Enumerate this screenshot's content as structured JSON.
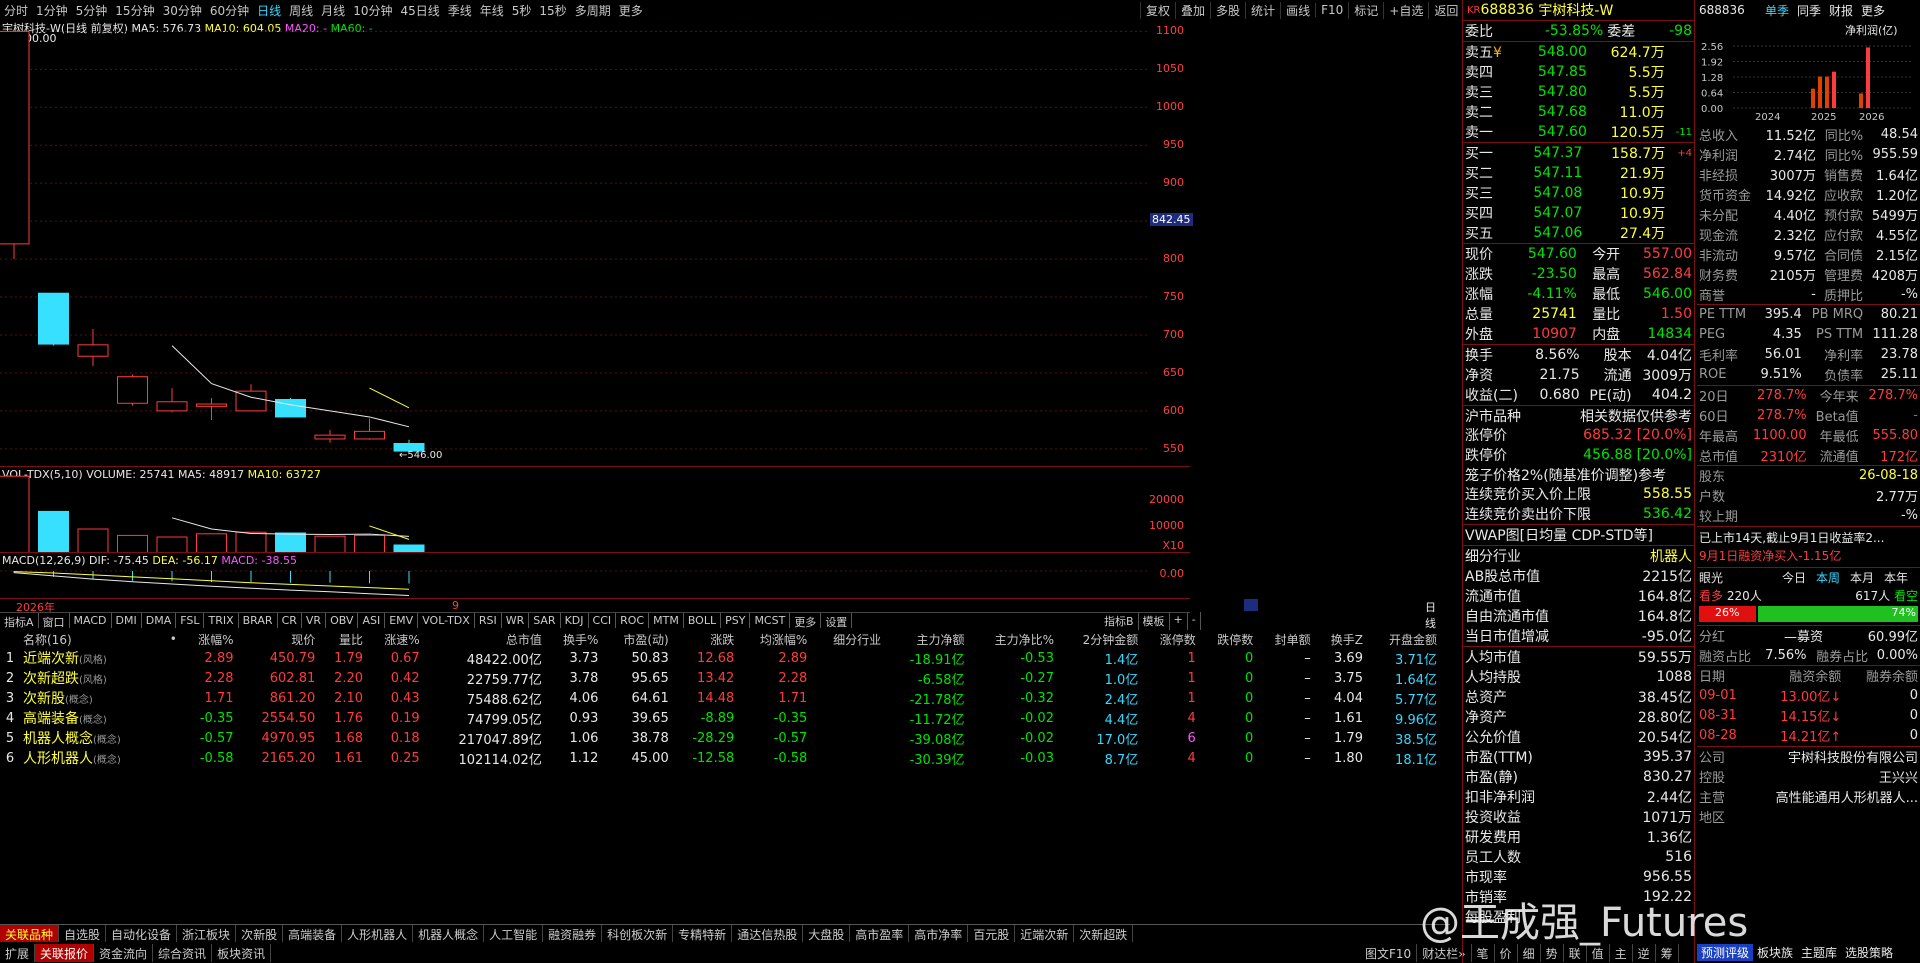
{
  "topbar": {
    "periods": [
      "分时",
      "1分钟",
      "5分钟",
      "15分钟",
      "30分钟",
      "60分钟",
      "日线",
      "周线",
      "月线",
      "10分钟",
      "45日线",
      "季线",
      "年线",
      "5秒",
      "15秒",
      "多周期",
      "更多"
    ],
    "active": "日线",
    "tools": [
      "复权",
      "叠加",
      "多股",
      "统计",
      "画线",
      "F10",
      "标记",
      "+自选",
      "返回"
    ]
  },
  "chart": {
    "title": "宇树科技-W(日线 前复权)",
    "ma5": "MA5: 576.73",
    "ma10": "MA10: 604.05",
    "ma20": "MA20: -",
    "ma60": "MA60: -",
    "high_label": "100.00",
    "low_label": "546.00",
    "cursor_price": "842.45",
    "y_ticks": [
      "1100",
      "1050",
      "1000",
      "950",
      "900",
      "850",
      "800",
      "750",
      "700",
      "650",
      "600",
      "550"
    ],
    "date_left": "2026年",
    "date_mid": "9",
    "date_label": "日线"
  },
  "chart_data": {
    "type": "candlestick",
    "candles": [
      {
        "o": 820,
        "c": 1100,
        "h": 1100,
        "l": 800
      },
      {
        "o": 755,
        "c": 688,
        "h": 755,
        "l": 686
      },
      {
        "o": 672,
        "c": 687,
        "h": 708,
        "l": 659
      },
      {
        "o": 610,
        "c": 645,
        "h": 648,
        "l": 607
      },
      {
        "o": 600,
        "c": 612,
        "h": 630,
        "l": 598
      },
      {
        "o": 606,
        "c": 609,
        "h": 617,
        "l": 588
      },
      {
        "o": 600,
        "c": 626,
        "h": 635,
        "l": 600
      },
      {
        "o": 615,
        "c": 592,
        "h": 617,
        "l": 592
      },
      {
        "o": 563,
        "c": 568,
        "h": 575,
        "l": 558
      },
      {
        "o": 563,
        "c": 573,
        "h": 590,
        "l": 562
      },
      {
        "o": 557,
        "c": 547,
        "h": 562,
        "l": 546
      }
    ],
    "ma5": [
      null,
      null,
      null,
      null,
      686,
      636,
      618,
      608,
      600,
      592,
      579
    ],
    "ma10": [
      null,
      null,
      null,
      null,
      null,
      null,
      null,
      null,
      null,
      630,
      604
    ],
    "volume": [
      48000,
      26000,
      15000,
      11000,
      10000,
      12000,
      13000,
      12500,
      10500,
      11000,
      5000
    ],
    "vol_ma5": [
      null,
      null,
      null,
      null,
      22000,
      15000,
      12200,
      11800,
      11600,
      11800,
      10400
    ],
    "vol_ma10": [
      null,
      null,
      null,
      null,
      null,
      null,
      null,
      null,
      null,
      16900,
      8500
    ],
    "macd_dif": [
      -5,
      -15,
      -25,
      -33,
      -40,
      -47,
      -53,
      -59,
      -64,
      -70,
      -75.45
    ],
    "macd_dea": [
      -2,
      -6,
      -12,
      -18,
      -24,
      -30,
      -36,
      -41,
      -46,
      -51,
      -56.17
    ]
  },
  "volpanel": {
    "title": "VOL-TDX(5,10)",
    "volume": "VOLUME: 25741",
    "ma5": "MA5: 48917",
    "ma10": "MA10: 63727",
    "ticks": [
      "20000",
      "10000"
    ],
    "unit": "X10"
  },
  "macdpanel": {
    "title": "MACD(12,26,9)",
    "dif": "DIF: -75.45",
    "dea": "DEA: -56.17",
    "macd": "MACD: -38.55",
    "tick": "0.00"
  },
  "indtabs": [
    "指标A",
    "窗口",
    "MACD",
    "DMI",
    "DMA",
    "FSL",
    "TRIX",
    "BRAR",
    "CR",
    "VR",
    "OBV",
    "ASI",
    "EMV",
    "VOL-TDX",
    "RSI",
    "WR",
    "SAR",
    "KDJ",
    "CCI",
    "ROC",
    "MTM",
    "BOLL",
    "PSY",
    "MCST",
    "更多",
    "设置"
  ],
  "indtabs_right": [
    "指标B",
    "模板",
    "+",
    "-"
  ],
  "list": {
    "headers": [
      "名称(16)",
      "•",
      "涨幅%",
      "现价",
      "量比",
      "涨速%",
      "总市值",
      "换手%",
      "市盈(动)",
      "涨跌",
      "均涨幅%",
      "细分行业",
      "主力净额",
      "主力净比%",
      "2分钟金额",
      "涨停数",
      "跌停数",
      "封单额",
      "换手Z",
      "开盘金额"
    ],
    "rows": [
      [
        "1",
        "近端次新",
        "(风格)",
        "2.89",
        "450.79",
        "1.79",
        "0.67",
        "48422.00亿",
        "3.73",
        "50.83",
        "12.68",
        "2.89",
        "",
        "-18.91亿",
        "-0.53",
        "1.4亿",
        "1",
        "0",
        "–",
        "3.69",
        "3.71亿"
      ],
      [
        "2",
        "次新超跌",
        "(风格)",
        "2.28",
        "602.81",
        "2.20",
        "0.42",
        "22759.77亿",
        "3.78",
        "95.65",
        "13.42",
        "2.28",
        "",
        "-6.58亿",
        "-0.27",
        "1.0亿",
        "1",
        "0",
        "–",
        "3.75",
        "1.64亿"
      ],
      [
        "3",
        "次新股",
        "(概念)",
        "1.71",
        "861.20",
        "2.10",
        "0.43",
        "75488.62亿",
        "4.06",
        "64.61",
        "14.48",
        "1.71",
        "",
        "-21.78亿",
        "-0.32",
        "2.4亿",
        "1",
        "0",
        "–",
        "4.04",
        "5.77亿"
      ],
      [
        "4",
        "高端装备",
        "(概念)",
        "-0.35",
        "2554.50",
        "1.76",
        "0.19",
        "74799.05亿",
        "0.93",
        "39.65",
        "-8.89",
        "-0.35",
        "",
        "-11.72亿",
        "-0.02",
        "4.4亿",
        "4",
        "0",
        "–",
        "1.61",
        "9.96亿"
      ],
      [
        "5",
        "机器人概念",
        "(概念)",
        "-0.57",
        "4970.95",
        "1.68",
        "0.18",
        "217047.89亿",
        "1.06",
        "38.78",
        "-28.29",
        "-0.57",
        "",
        "-39.08亿",
        "-0.02",
        "17.0亿",
        "6",
        "0",
        "–",
        "1.79",
        "38.5亿"
      ],
      [
        "6",
        "人形机器人",
        "(概念)",
        "-0.58",
        "2165.20",
        "1.61",
        "0.25",
        "102114.02亿",
        "1.12",
        "45.00",
        "-12.58",
        "-0.58",
        "",
        "-30.39亿",
        "-0.03",
        "8.7亿",
        "4",
        "0",
        "–",
        "1.80",
        "18.1亿"
      ]
    ]
  },
  "sectabs": [
    "关联品种",
    "自选股",
    "自动化设备",
    "浙江板块",
    "次新股",
    "高端装备",
    "人形机器人",
    "机器人概念",
    "人工智能",
    "融资融券",
    "科创板次新",
    "专精特新",
    "通达信热股",
    "大盘股",
    "高市盈率",
    "高市净率",
    "百元股",
    "近端次新",
    "次新超跌"
  ],
  "bottom": [
    "扩展",
    "关联报价",
    "资金流向",
    "综合资讯",
    "板块资讯"
  ],
  "bottom_right": [
    "图文F10",
    "财达栏»",
    "笔",
    "价",
    "细",
    "势",
    "联",
    "值",
    "主",
    "逆",
    "筹"
  ],
  "quote": {
    "code": "688836",
    "name": "宇树科技-W",
    "prefix": "KR",
    "weibi_label": "委比",
    "weibi": "-53.85%",
    "weicha_label": "委差",
    "weicha": "-98",
    "asks": [
      [
        "卖五",
        "¥",
        "548.00",
        "624.7万",
        ""
      ],
      [
        "卖四",
        "",
        "547.85",
        "5.5万",
        ""
      ],
      [
        "卖三",
        "",
        "547.80",
        "5.5万",
        ""
      ],
      [
        "卖二",
        "",
        "547.68",
        "11.0万",
        ""
      ],
      [
        "卖一",
        "",
        "547.60",
        "120.5万",
        "-11"
      ]
    ],
    "bids": [
      [
        "买一",
        "547.37",
        "158.7万",
        "+4"
      ],
      [
        "买二",
        "547.11",
        "21.9万",
        ""
      ],
      [
        "买三",
        "547.08",
        "10.9万",
        ""
      ],
      [
        "买四",
        "547.07",
        "10.9万",
        ""
      ],
      [
        "买五",
        "547.06",
        "27.4万",
        ""
      ]
    ],
    "stats": [
      [
        "现价",
        "547.60",
        "今开",
        "557.00"
      ],
      [
        "涨跌",
        "-23.50",
        "最高",
        "562.84"
      ],
      [
        "涨幅",
        "-4.11%",
        "最低",
        "546.00"
      ],
      [
        "总量",
        "25741",
        "量比",
        "1.50"
      ],
      [
        "外盘",
        "10907",
        "内盘",
        "14834"
      ]
    ],
    "stats2": [
      [
        "换手",
        "8.56%",
        "股本",
        "4.04亿"
      ],
      [
        "净资",
        "21.75",
        "流通",
        "3009万"
      ],
      [
        "收益(二)",
        "0.680",
        "PE(动)",
        "404.2"
      ]
    ],
    "market": "沪市品种",
    "market_note": "相关数据仅供参考",
    "limits": [
      [
        "涨停价",
        "685.32 [20.0%]"
      ],
      [
        "跌停价",
        "456.88 [20.0%]"
      ]
    ],
    "cage": "笼子价格2%(随基准价调整)参考",
    "auction": [
      [
        "连续竞价买入价上限",
        "558.55"
      ],
      [
        "连续竞价卖出价下限",
        "536.42"
      ]
    ],
    "vwap": "VWAP图[日均量 CDP-STD等]",
    "info": [
      [
        "细分行业",
        "机器人"
      ],
      [
        "AB股总市值",
        "2215亿"
      ],
      [
        "流通市值",
        "164.8亿"
      ],
      [
        "自由流通市值",
        "164.8亿"
      ],
      [
        "当日市值增减",
        "-95.0亿"
      ]
    ],
    "info2": [
      [
        "人均市值",
        "59.55万"
      ],
      [
        "人均持股",
        "1088"
      ],
      [
        "总资产",
        "38.45亿"
      ],
      [
        "净资产",
        "28.80亿"
      ],
      [
        "公允价值",
        "20.54亿"
      ],
      [
        "市盈(TTM)",
        "395.37"
      ],
      [
        "市盈(静)",
        "830.27"
      ],
      [
        "扣非净利润",
        "2.44亿"
      ],
      [
        "投资收益",
        "1071万"
      ],
      [
        "研发费用",
        "1.36亿"
      ],
      [
        "员工人数",
        "516"
      ],
      [
        "市现率",
        "956.55"
      ],
      [
        "市销率",
        "192.22"
      ],
      [
        "每股盈利",
        "-"
      ]
    ]
  },
  "fin": {
    "code": "688836",
    "tabs": [
      "单季",
      "同季",
      "财报",
      "更多"
    ],
    "chart_title": "净利润(亿)",
    "yticks": [
      "2.56",
      "1.92",
      "1.28",
      "0.64",
      "0.00"
    ],
    "years": [
      "2024",
      "2025",
      "2026"
    ],
    "bars": [
      {
        "year": 0,
        "values": []
      },
      {
        "year": 1,
        "values": [
          0.8,
          1.3,
          1.3,
          1.5
        ]
      },
      {
        "year": 2,
        "values": [
          0.6,
          2.5
        ]
      }
    ],
    "rows": [
      [
        "总收入",
        "11.52亿",
        "同比%",
        "48.54"
      ],
      [
        "净利润",
        "2.74亿",
        "同比%",
        "955.59"
      ],
      [
        "非经损",
        "3007万",
        "销售费",
        "1.64亿"
      ],
      [
        "货币资金",
        "14.92亿",
        "应收款",
        "1.20亿"
      ],
      [
        "未分配",
        "4.40亿",
        "预付款",
        "5499万"
      ],
      [
        "现金流",
        "2.32亿",
        "应付款",
        "4.55亿"
      ],
      [
        "非流动",
        "9.57亿",
        "合同债",
        "2.15亿"
      ],
      [
        "财务费",
        "2105万",
        "管理费",
        "4208万"
      ],
      [
        "商誉",
        "-",
        "质押比",
        "-%"
      ]
    ],
    "val": [
      [
        "PE TTM",
        "395.4",
        "PB MRQ",
        "80.21"
      ],
      [
        "PEG",
        "4.35",
        "PS TTM",
        "111.28"
      ],
      [
        "毛利率",
        "56.01",
        "净利率",
        "23.78"
      ],
      [
        "ROE",
        "9.51%",
        "负债率",
        "25.11"
      ]
    ],
    "perf": [
      [
        "20日",
        "278.7%",
        "今年来",
        "278.7%"
      ],
      [
        "60日",
        "278.7%",
        "Beta值",
        "-"
      ],
      [
        "年最高",
        "1100.00",
        "年最低",
        "555.80"
      ],
      [
        "总市值",
        "2310亿",
        "流通值",
        "172亿"
      ]
    ],
    "holders": [
      [
        "股东",
        "26-08-18"
      ],
      [
        "户数",
        "2.77万"
      ],
      [
        "较上期",
        "-%"
      ]
    ],
    "news1": "已上市14天,截止9月1日收益率2...",
    "news2": "9月1日融资净买入-1.15亿",
    "poll_label": "眼光",
    "poll_tabs": [
      "今日",
      "本周",
      "本月",
      "本年"
    ],
    "bull_label": "看多",
    "bull_count": "220人",
    "bear_count": "617人",
    "bear_label": "看空",
    "bull_pct": "26%",
    "bear_pct": "74%",
    "bull_frac": 0.26,
    "dividend": [
      [
        "分红",
        "—募资",
        "60.99亿"
      ]
    ],
    "margin": [
      [
        "融资占比",
        "7.56%",
        "融券占比",
        "0.00%"
      ]
    ],
    "mhead": [
      "日期",
      "融资余额",
      "融券余额"
    ],
    "mrows": [
      [
        "09-01",
        "13.00亿↓",
        "0"
      ],
      [
        "08-31",
        "14.15亿↓",
        "0"
      ],
      [
        "08-28",
        "14.21亿↑",
        "0"
      ]
    ],
    "company": [
      [
        "公司",
        "宇树科技股份有限公司"
      ],
      [
        "控股",
        "王兴兴"
      ],
      [
        "主营",
        "高性能通用人形机器人..."
      ],
      [
        "地区",
        ""
      ]
    ],
    "links": [
      "预测评级",
      "板块族",
      "主题库",
      "选股策略"
    ]
  },
  "watermark": "@王成强_Futures"
}
